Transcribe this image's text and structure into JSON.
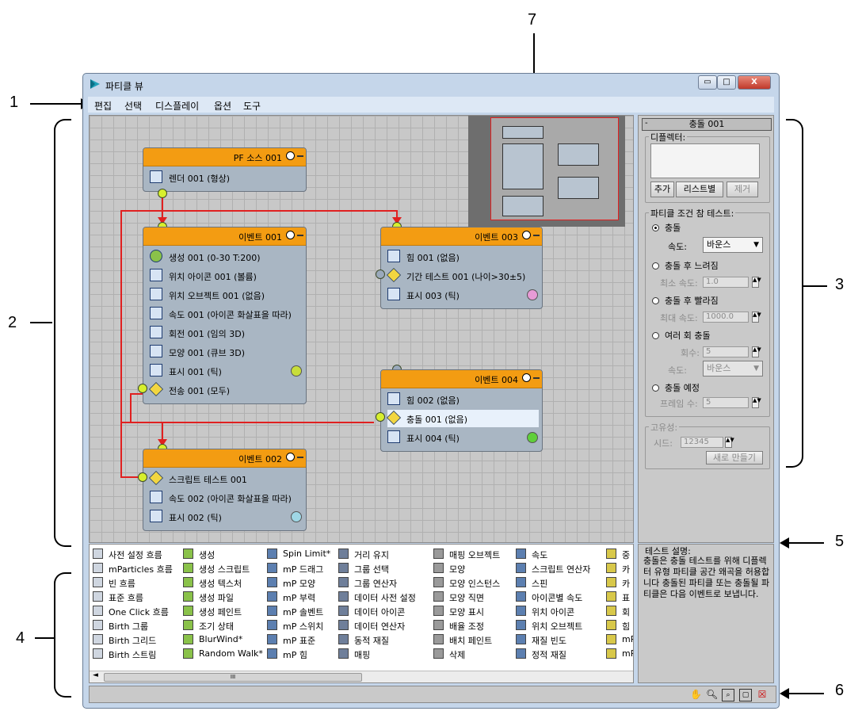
{
  "callouts": [
    "1",
    "2",
    "3",
    "4",
    "5",
    "6",
    "7"
  ],
  "window": {
    "title": "파티클 뷰",
    "menu": [
      "편집",
      "선택",
      "디스플레이",
      "옵션",
      "도구"
    ],
    "controls": {
      "minimize": "▭",
      "maximize": "□",
      "close": "X"
    }
  },
  "nodes": {
    "pf_source": {
      "title": "PF 소스 001",
      "ops": [
        "렌더 001 (형상)"
      ]
    },
    "event001": {
      "title": "이벤트 001",
      "ops": [
        "생성 001 (0-30 T:200)",
        "위치 아이콘 001 (볼륨)",
        "위치 오브젝트 001 (없음)",
        "속도 001 (아이콘 화살표을 따라)",
        "회전 001 (임의 3D)",
        "모양 001 (큐브 3D)",
        "표시 001 (틱)",
        "전송 001 (모두)"
      ]
    },
    "event002": {
      "title": "이벤트 002",
      "ops": [
        "스크립트 테스트 001",
        "속도 002 (아이콘 화살표을 따라)",
        "표시 002 (틱)"
      ]
    },
    "event003": {
      "title": "이벤트 003",
      "ops": [
        "힘 001 (없음)",
        "기간 테스트 001 (나이>30±5)",
        "표시 003 (틱)"
      ]
    },
    "event004": {
      "title": "이벤트 004",
      "ops": [
        "힘 002 (없음)",
        "충돌 001 (없음)",
        "표시 004 (틱)"
      ]
    }
  },
  "colors": {
    "event_header": "#f39c12",
    "wire": "#e02020",
    "display_001": "#c8de3a",
    "display_002": "#9fd7e6",
    "display_003": "#e79bd6",
    "display_004": "#5fcf3a"
  },
  "panel": {
    "header": "충돌 001",
    "deflectors_group": "디플렉터:",
    "add": "추가",
    "by_list": "리스트별",
    "remove": "제거",
    "test_group": "파티클 조건 참 테스트:",
    "collides": "충돌",
    "speed_label": "속도:",
    "speed_value": "바운스",
    "collides_slow": "충돌 후 느려짐",
    "min_speed": "최소 속도:",
    "min_speed_val": "1.0",
    "collides_fast": "충돌 후 빨라짐",
    "max_speed": "최대 속도:",
    "max_speed_val": "1000.0",
    "collides_multi": "여러 회 충돌",
    "count_label": "회수:",
    "count_val": "5",
    "speed2_label": "속도:",
    "speed2_val": "바운스",
    "will_collide": "충돌 예정",
    "frames_label": "프레임 수:",
    "frames_val": "5",
    "unique_group": "고유성:",
    "seed_label": "시드:",
    "seed_val": "12345",
    "new_btn": "새로 만들기"
  },
  "depot": {
    "columns": [
      [
        "사전 설정 흐름",
        "mParticles 흐름",
        "빈 흐름",
        "표준 흐름",
        "One Click 흐름",
        "Birth 그룹",
        "Birth 그리드",
        "Birth 스트림"
      ],
      [
        "생성",
        "생성 스크립트",
        "생성 텍스처",
        "생성 파일",
        "생성 페인트",
        "조기 상태",
        "BlurWind*",
        "Random Walk*"
      ],
      [
        "Spin Limit*",
        "mP 드래그",
        "mP 모양",
        "mP 부력",
        "mP 솔벤트",
        "mP 스위치",
        "mP 표준",
        "mP 힘"
      ],
      [
        "거리 유지",
        "그룹 선택",
        "그룹 연산자",
        "데이터 사전 설정",
        "데이터 아이콘",
        "데이터 연산자",
        "동적 재질",
        "매핑"
      ],
      [
        "매핑 오브젝트",
        "모양",
        "모양 인스턴스",
        "모양 직면",
        "모양 표시",
        "배율 조정",
        "배치 페인트",
        "삭제"
      ],
      [
        "속도",
        "스크립트 연산자",
        "스핀",
        "아이콘별 속도",
        "위치 아이콘",
        "위치 오브젝트",
        "재질 빈도",
        "정적 재질"
      ],
      [
        "중",
        "카",
        "카",
        "표",
        "회",
        "힘",
        "mP",
        "mP"
      ]
    ],
    "scroll_grip": "III"
  },
  "description": {
    "title": "테스트 설명:",
    "text": "충돌은 충돌 테스트를 위해 디플렉터 유형 파티클 공간 왜곡을 허용합니다 충돌된 파티클 또는 충돌될 파티클은 다음 이벤트로 보냅니다."
  },
  "status": {
    "icons": [
      "pan-icon",
      "zoom-icon",
      "zoom-region-icon",
      "zoom-extents-icon",
      "no-overview-icon"
    ]
  }
}
